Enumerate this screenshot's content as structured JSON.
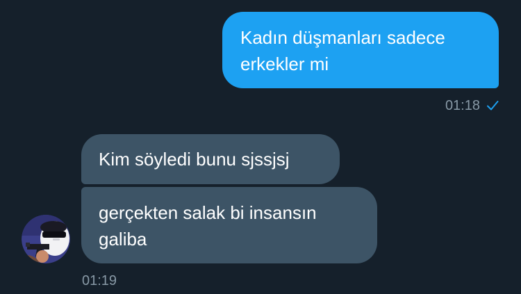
{
  "conversation": {
    "messages": [
      {
        "direction": "outgoing",
        "lines": [
          "Kadın düşmanları sadece",
          "erkekler mi"
        ],
        "time": "01:18",
        "status_icon": "check-icon",
        "status_color": "#1da1f2"
      },
      {
        "direction": "incoming",
        "lines": [
          "Kim söyledi bunu sjssjsj"
        ]
      },
      {
        "direction": "incoming",
        "lines": [
          "gerçekten salak bi insansın",
          "galiba"
        ],
        "time": "01:19"
      }
    ],
    "avatar_icon": "masked-person-with-gun-avatar"
  },
  "colors": {
    "background": "#15202b",
    "outgoing_bubble": "#1da1f2",
    "incoming_bubble": "#3d5466",
    "timestamp": "#8899a6"
  }
}
